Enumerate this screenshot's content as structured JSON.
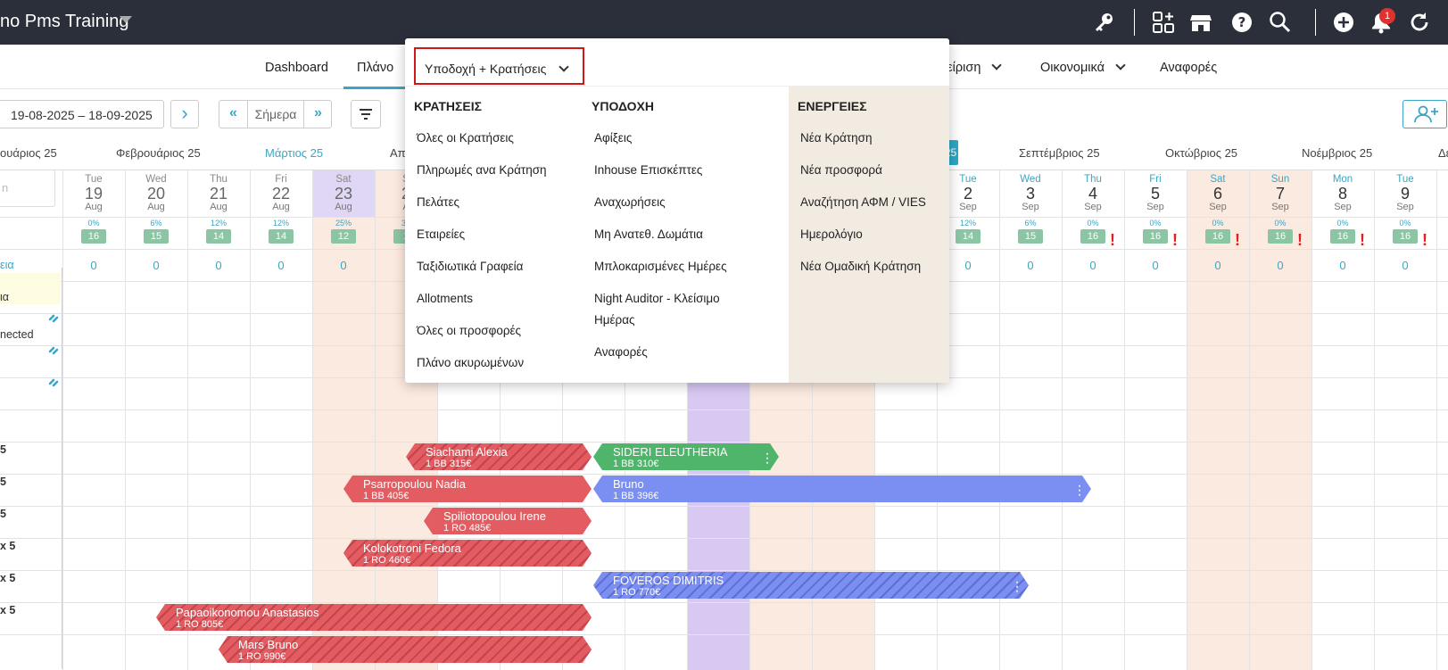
{
  "topbar": {
    "app_title": "no Pms Training",
    "icons": [
      "key-icon",
      "apps-add-icon",
      "store-icon",
      "help-icon",
      "search-icon",
      "add-circle-icon",
      "bell-icon",
      "refresh-icon"
    ],
    "notification_count": "1",
    "background": "#2b2f3a"
  },
  "nav": {
    "dashboard": "Dashboard",
    "plano": "Πλάνο",
    "management": "ιείριση",
    "finance": "Οικονομικά",
    "reports": "Αναφορές",
    "accent": "#3aa6c5"
  },
  "toolbar": {
    "date_range": "19-08-2025 – 18-09-2025",
    "today": "Σήμερα",
    "prev_symbol": "«",
    "next_symbol": "»",
    "next_arrow": "›"
  },
  "months": {
    "jan": "ουάριος 25",
    "feb": "Φεβρουάριος 25",
    "mar": "Μάρτιος 25",
    "apr": "Απρ",
    "aug_pill": "25",
    "sep": "Σεπτέμβριος 25",
    "oct": "Οκτώβριος 25",
    "nov": "Νοέμβριος 25",
    "dec": "Δε"
  },
  "days": [
    {
      "dow": "Tue",
      "num": "19",
      "mon": "Aug",
      "pct": "0%",
      "avail": "16",
      "warn": false
    },
    {
      "dow": "Wed",
      "num": "20",
      "mon": "Aug",
      "pct": "6%",
      "avail": "15",
      "warn": false
    },
    {
      "dow": "Thu",
      "num": "21",
      "mon": "Aug",
      "pct": "12%",
      "avail": "14",
      "warn": false
    },
    {
      "dow": "Fri",
      "num": "22",
      "mon": "Aug",
      "pct": "12%",
      "avail": "14",
      "warn": false
    },
    {
      "dow": "Sat",
      "num": "23",
      "mon": "Aug",
      "pct": "25%",
      "avail": "12",
      "warn": false
    },
    {
      "dow": "S",
      "num": "2",
      "mon": "A",
      "pct": "38",
      "avail": "1",
      "warn": false
    },
    {
      "dow": "Tue",
      "num": "2",
      "mon": "Sep",
      "pct": "12%",
      "avail": "14",
      "warn": false
    },
    {
      "dow": "Wed",
      "num": "3",
      "mon": "Sep",
      "pct": "6%",
      "avail": "15",
      "warn": false
    },
    {
      "dow": "Thu",
      "num": "4",
      "mon": "Sep",
      "pct": "0%",
      "avail": "16",
      "warn": true
    },
    {
      "dow": "Fri",
      "num": "5",
      "mon": "Sep",
      "pct": "0%",
      "avail": "16",
      "warn": true
    },
    {
      "dow": "Sat",
      "num": "6",
      "mon": "Sep",
      "pct": "0%",
      "avail": "16",
      "warn": true
    },
    {
      "dow": "Sun",
      "num": "7",
      "mon": "Sep",
      "pct": "0%",
      "avail": "16",
      "warn": true
    },
    {
      "dow": "Mon",
      "num": "8",
      "mon": "Sep",
      "pct": "0%",
      "avail": "16",
      "warn": true
    },
    {
      "dow": "Tue",
      "num": "9",
      "mon": "Sep",
      "pct": "0%",
      "avail": "16",
      "warn": true
    }
  ],
  "zero_value": "0",
  "search_placeholder": "n",
  "room_labels": {
    "r0": "εια",
    "r1": "ια",
    "r2": "nected",
    "r3": "5",
    "r4": "5",
    "r5": "5",
    "r6": "x 5",
    "r7": "x 5",
    "r8": "x 5"
  },
  "bookings": {
    "siachami": {
      "name": "Siachami Alexia",
      "details": "1  BB  315€"
    },
    "sideri": {
      "name": "SIDERI ELEUTHERIA",
      "details": "1  BB  310€"
    },
    "psarropoulou": {
      "name": "Psarropoulou Nadia",
      "details": "1  BB  405€"
    },
    "bruno": {
      "name": "Bruno",
      "details": "1  BB  396€"
    },
    "spiliotopoulou": {
      "name": "Spiliotopoulou Irene",
      "details": "1  RO  485€"
    },
    "kolokotroni": {
      "name": "Kolokotroni Fedora",
      "details": "1  RO  460€"
    },
    "foveros": {
      "name": "FOVEROS DIMITRIS",
      "details": "1  RO  770€"
    },
    "papaoikonomou": {
      "name": "Papaoikonomou Anastasios",
      "details": "1  RO  805€"
    },
    "mars": {
      "name": "Mars Bruno",
      "details": "1  RO  990€"
    }
  },
  "dropdown": {
    "selected": "Υποδοχή + Κρατήσεις",
    "reservations": {
      "title": "ΚΡΑΤΗΣΕΙΣ",
      "items": [
        "Όλες οι Κρατήσεις",
        "Πληρωμές ανα Κράτηση",
        "Πελάτες",
        "Εταιρείες",
        "Ταξιδιωτικά Γραφεία",
        "Allotments",
        "Όλες οι προσφορές",
        "Πλάνο ακυρωμένων"
      ]
    },
    "reception": {
      "title": "ΥΠΟΔΟΧΗ",
      "items": [
        "Αφίξεις",
        "Inhouse Επισκέπτες",
        "Αναχωρήσεις",
        "Μη Ανατεθ. Δωμάτια",
        "Μπλοκαρισμένες Ημέρες",
        "Night Auditor - Κλείσιμο",
        "Ημέρας",
        "Αναφορές"
      ]
    },
    "actions": {
      "title": "ΕΝΕΡΓΕΙΕΣ",
      "items": [
        "Νέα Κράτηση",
        "Νέα προσφορά",
        "Αναζήτηση ΑΦΜ / VIES",
        "Ημερολόγιο",
        "Νέα Ομαδική Κράτηση"
      ]
    },
    "highlight_border": "#d01818"
  }
}
